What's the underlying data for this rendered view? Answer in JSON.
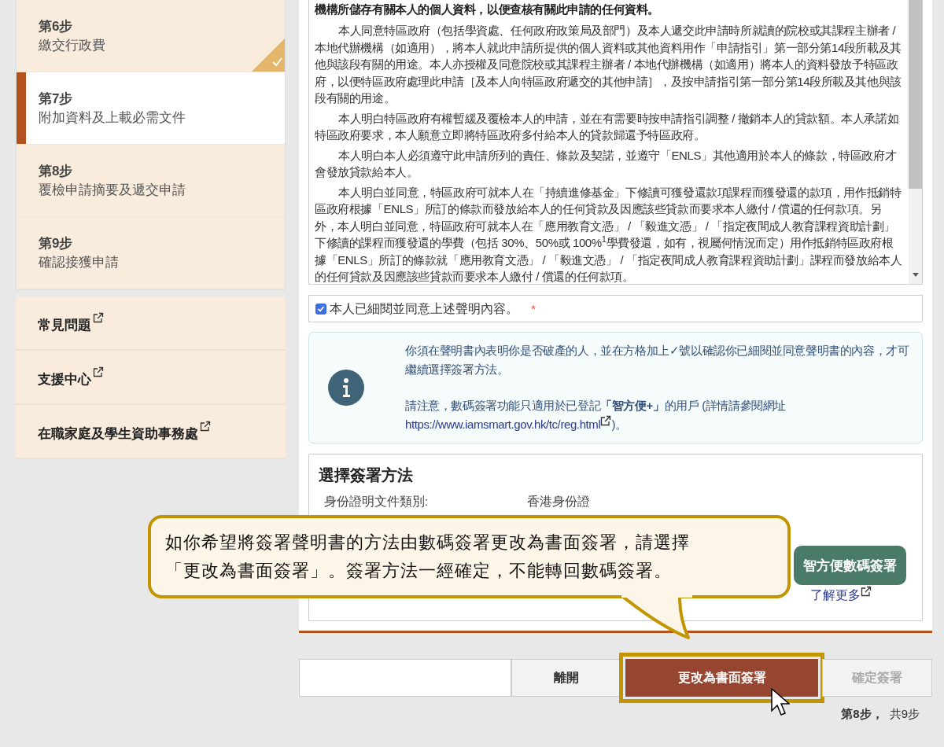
{
  "sidebar": {
    "steps": [
      {
        "step": "第6步",
        "title": "繳交行政費",
        "completed": true,
        "selected": false
      },
      {
        "step": "第7步",
        "title": "附加資料及上載必需文件",
        "completed": false,
        "selected": true
      },
      {
        "step": "第8步",
        "title": "覆檢申請摘要及遞交申請",
        "completed": false,
        "selected": false
      },
      {
        "step": "第9步",
        "title": "確認接獲申請",
        "completed": false,
        "selected": false
      }
    ],
    "links": [
      {
        "label": "常見問題"
      },
      {
        "label": "支援中心"
      },
      {
        "label": "在職家庭及學生資助事務處"
      }
    ]
  },
  "declaration": {
    "paragraphs": [
      {
        "kind": "heading",
        "text": "機構所儲存有關本人的個人資料，以便查核有關此申請的任何資料。"
      },
      {
        "kind": "body",
        "text": "本人同意特區政府（包括學資處、任何政府政策局及部門）及本人遞交此申請時所就讀的院校或其課程主辦者 / 本地代辦機構（如適用），將本人就此申請所提供的個人資料或其他資料用作「申請指引」第一部分第14段所載及其他與該段有關的用途。本人亦授權及同意院校或其課程主辦者 / 本地代辦機構（如適用）將本人的資料發放予特區政府，以便特區政府處理此申請［及本人向特區政府遞交的其他申請］，及按申請指引第一部分第14段所載及其他與該段有關的用途。"
      },
      {
        "kind": "body",
        "text": "本人明白特區政府有權暫緩及覆檢本人的申請，並在有需要時按申請指引調整 / 撤銷本人的貸款額。本人承諾如特區政府要求，本人願意立即將特區政府多付給本人的貸款歸還予特區政府。"
      },
      {
        "kind": "body",
        "text": "本人明白本人必須遵守此申請所列的責任、條款及契諾，並遵守「ENLS」其他適用於本人的條款，特區政府才會發放貸款給本人。"
      },
      {
        "kind": "body",
        "text": "本人明白並同意，特區政府可就本人在「持續進修基金」下修讀可獲發還款項課程而獲發還的款項，用作抵銷特區政府根據「ENLS」所訂的條款而發放給本人的任何貸款及因應該些貸款而要求本人繳付 / 償還的任何款項。另外，本人明白並同意，特區政府可就本人在「應用教育文憑」 / 「毅進文憑」 / 「指定夜間成人教育課程資助計劃」下修讀的課程而獲發還的學費（包括 30%、50%或 100%$^{1}$學費發還，如有，視屬何情況而定）用作抵銷特區政府根據「ENLS」所訂的條款就「應用教育文憑」 / 「毅進文憑」 / 「指定夜間成人教育課程資助計劃」課程而發放給本人的任何貸款及因應該些貸款而要求本人繳付 / 償還的任何款項。"
      }
    ]
  },
  "agreement": {
    "label": "本人已細閱並同意上述聲明內容。",
    "required_mark": "*",
    "checked": true
  },
  "notice": {
    "line_1": "你須在聲明書內表明你是否破產的人，並在方格加上✓號以確認你已細閱並同意聲明書的內容，才可繼續選擇簽署方法。",
    "line_2": "請注意，數碼簽署功能只適用於已登記**「智方便+」**的用戶 (詳情請參閱網址",
    "link": "https://www.iamsmart.gov.hk/tc/reg.html",
    "after_link": ")。"
  },
  "signing": {
    "title": "選擇簽署方法",
    "id_label": "身份證明文件類別:",
    "id_value": "香港身份證",
    "digital_button": "智方便數碼簽署",
    "learn_more": "了解更多"
  },
  "callout": {
    "lines": [
      "如你希望將簽署聲明書的方法由數碼簽署更改為書面簽署，請選擇",
      "「更改為書面簽署」。簽署方法一經確定，不能轉回數碼簽署。"
    ]
  },
  "actions": [
    {
      "label": "離開",
      "kind": "secondary",
      "disabled": false,
      "highlighted": false
    },
    {
      "label": "更改為書面簽署",
      "kind": "primary",
      "disabled": false,
      "highlighted": true
    },
    {
      "label": "確定簽署",
      "kind": "secondary",
      "disabled": true,
      "highlighted": false
    }
  ],
  "progress": {
    "current": "第8步，",
    "total": "共9步"
  }
}
